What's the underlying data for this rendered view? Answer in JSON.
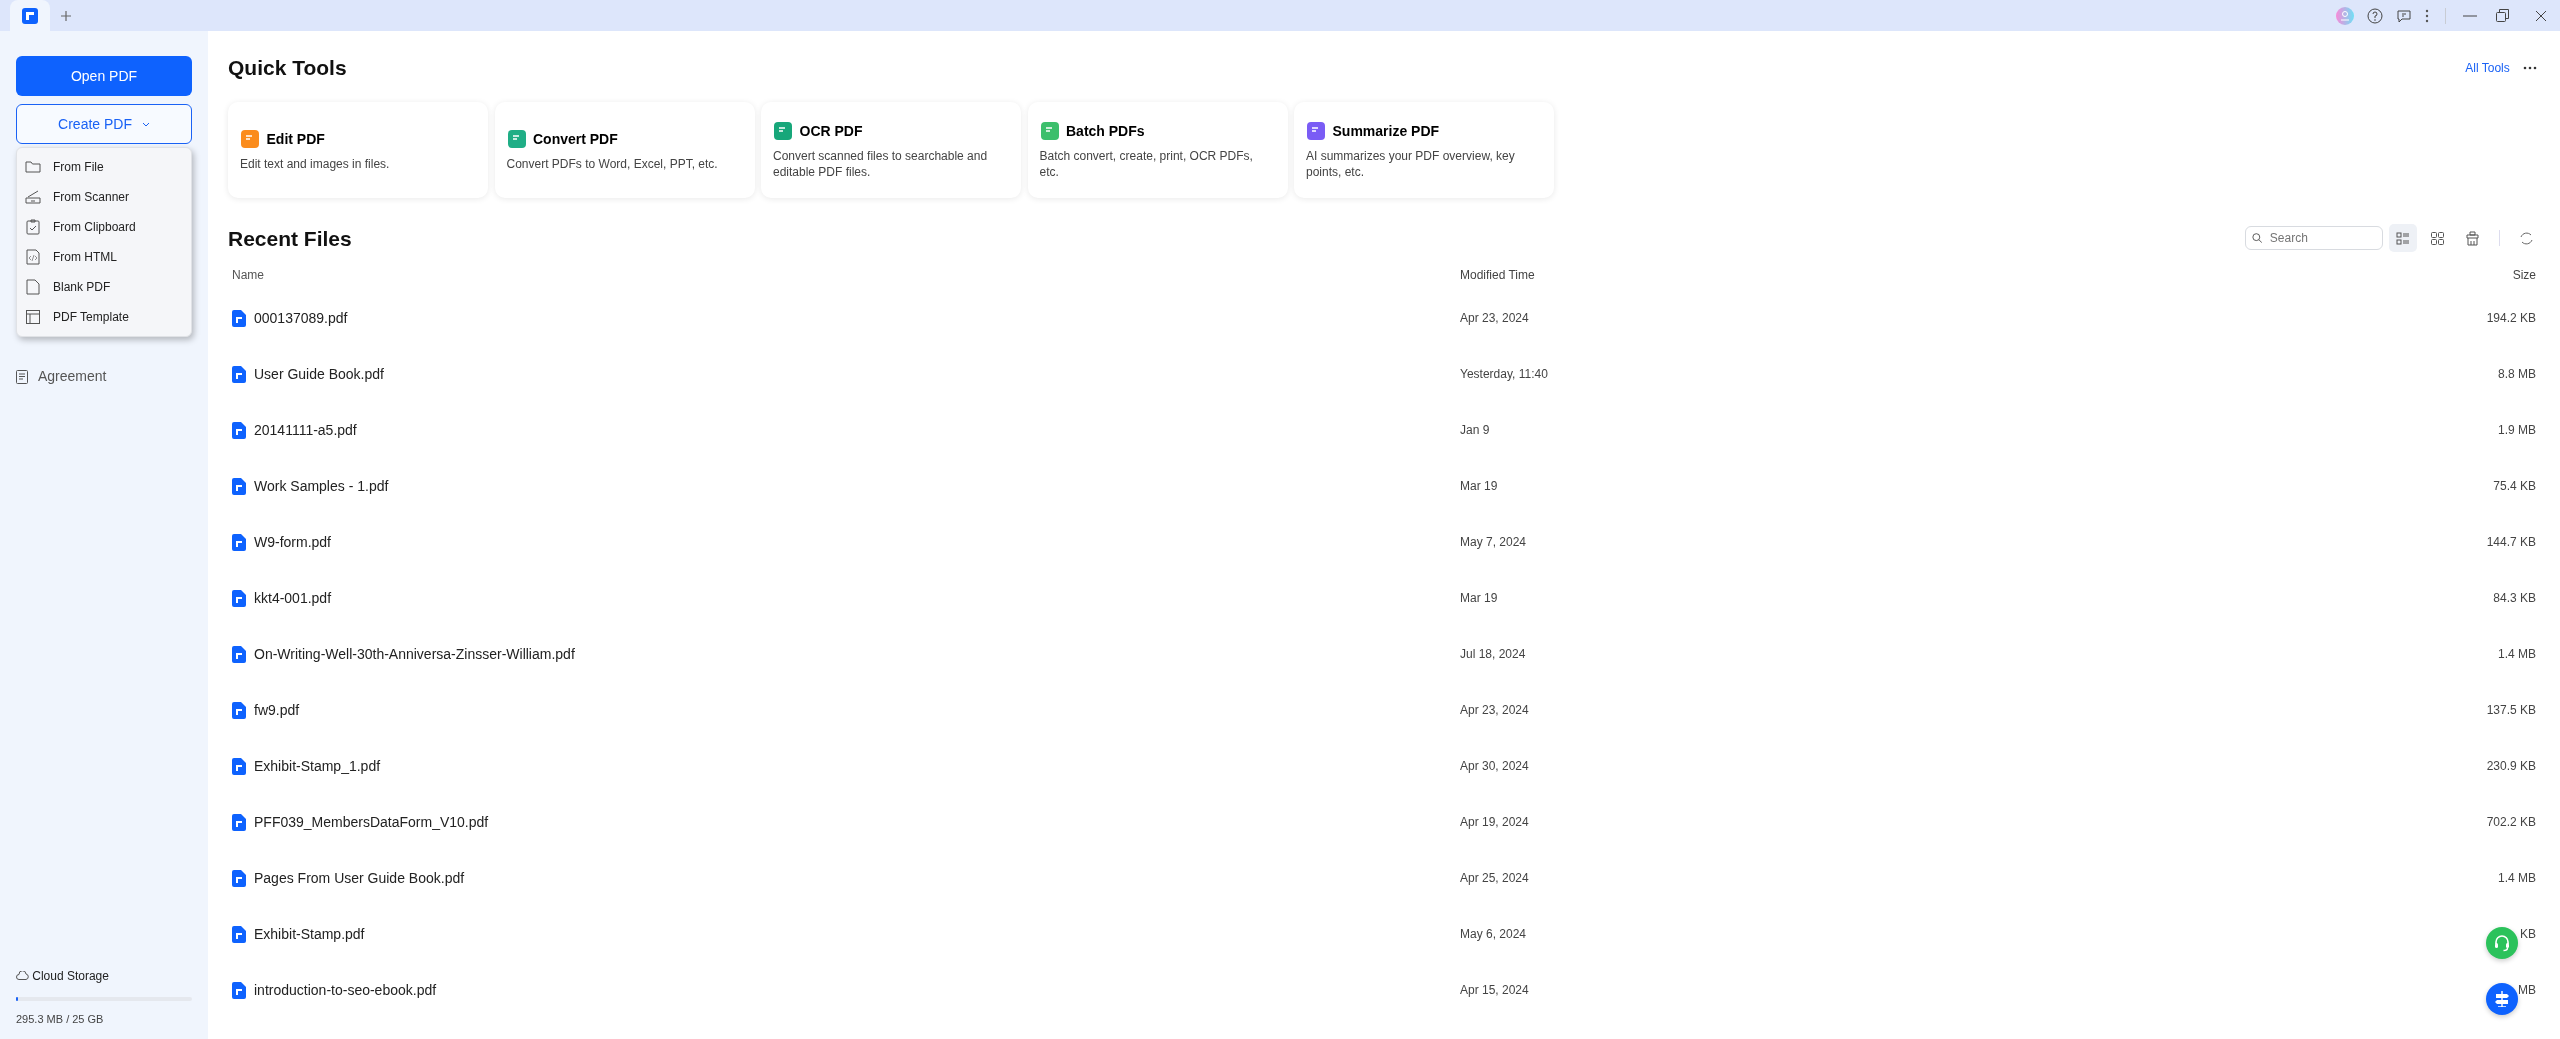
{
  "sidebar": {
    "open_button": "Open PDF",
    "create_button": {
      "label": "Create PDF",
      "expanded": true
    },
    "create_menu": [
      {
        "kind": "folder",
        "label": "From File"
      },
      {
        "kind": "scanner",
        "label": "From Scanner"
      },
      {
        "kind": "clipboard",
        "label": "From Clipboard"
      },
      {
        "kind": "html",
        "label": "From HTML"
      },
      {
        "kind": "blank",
        "label": "Blank PDF"
      },
      {
        "kind": "template",
        "label": "PDF Template"
      }
    ],
    "nav_items": [
      {
        "label": "Agreement"
      }
    ],
    "cloud_storage": {
      "label": "Cloud Storage",
      "level": 0.012,
      "usage": "295.3 MB / 25 GB"
    }
  },
  "quick_tools": {
    "title": "Quick Tools",
    "all_tools_link": "All Tools",
    "tools": [
      {
        "name": "Edit PDF",
        "description": "Edit text and images in files.",
        "color": "#fb8c1c"
      },
      {
        "name": "Convert PDF",
        "description": "Convert PDFs to Word, Excel, PPT, etc.",
        "color": "#1fae86"
      },
      {
        "name": "OCR PDF",
        "description": "Convert scanned files to searchable and editable PDF files.",
        "color": "#17a77a"
      },
      {
        "name": "Batch PDFs",
        "description": "Batch convert, create, print, OCR PDFs, etc.",
        "color": "#3cbf6c"
      },
      {
        "name": "Summarize PDF",
        "description": "AI summarizes your PDF overview, key points, etc.",
        "color": "#7a5cf5"
      }
    ]
  },
  "recent_files": {
    "title": "Recent Files",
    "search": {
      "placeholder": "Search"
    },
    "view_buttons": [
      {
        "kind": "list",
        "selected": true
      },
      {
        "kind": "grid",
        "selected": false
      }
    ],
    "columns": [
      "Name",
      "Modified Time",
      "Size"
    ],
    "rows": [
      {
        "name": "000137089.pdf",
        "modified": "Apr 23, 2024",
        "size": "194.2 KB"
      },
      {
        "name": "User Guide Book.pdf",
        "modified": "Yesterday, 11:40",
        "size": "8.8 MB"
      },
      {
        "name": "20141111-a5.pdf",
        "modified": "Jan 9",
        "size": "1.9 MB"
      },
      {
        "name": "Work Samples - 1.pdf",
        "modified": "Mar 19",
        "size": "75.4 KB"
      },
      {
        "name": "W9-form.pdf",
        "modified": "May 7, 2024",
        "size": "144.7 KB"
      },
      {
        "name": "kkt4-001.pdf",
        "modified": "Mar 19",
        "size": "84.3 KB"
      },
      {
        "name": "On-Writing-Well-30th-Anniversa-Zinsser-William.pdf",
        "modified": "Jul 18, 2024",
        "size": "1.4 MB"
      },
      {
        "name": "fw9.pdf",
        "modified": "Apr 23, 2024",
        "size": "137.5 KB"
      },
      {
        "name": "Exhibit-Stamp_1.pdf",
        "modified": "Apr 30, 2024",
        "size": "230.9 KB"
      },
      {
        "name": "PFF039_MembersDataForm_V10.pdf",
        "modified": "Apr 19, 2024",
        "size": "702.2 KB"
      },
      {
        "name": "Pages From User Guide Book.pdf",
        "modified": "Apr 25, 2024",
        "size": "1.4 MB"
      },
      {
        "name": "Exhibit-Stamp.pdf",
        "modified": "May 6, 2024",
        "size": "KB"
      },
      {
        "name": "introduction-to-seo-ebook.pdf",
        "modified": "Apr 15, 2024",
        "size": "MB"
      }
    ]
  }
}
